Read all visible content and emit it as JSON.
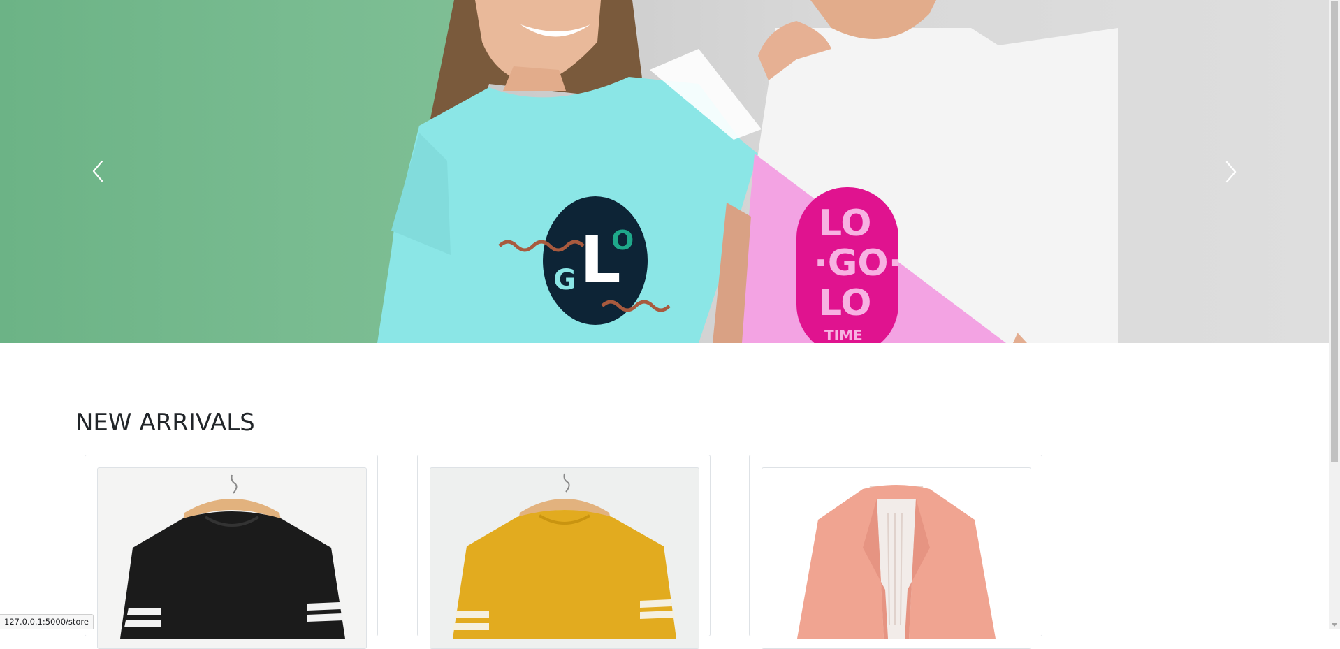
{
  "hero": {
    "prev_icon": "chevron-left-icon",
    "next_icon": "chevron-right-icon",
    "shirt_logo_left": "GLO",
    "shirt_logo_right": [
      "LO",
      "GO",
      "LO",
      "TIME"
    ]
  },
  "new_arrivals": {
    "title": "NEW ARRIVALS",
    "products": [
      {
        "name": "black-sweatshirt",
        "color": "#161616"
      },
      {
        "name": "mustard-sweatshirt",
        "color": "#e0aa1d"
      },
      {
        "name": "pink-blazer",
        "color": "#f0a693"
      }
    ]
  },
  "status_bar": {
    "url": "127.0.0.1:5000/store"
  }
}
